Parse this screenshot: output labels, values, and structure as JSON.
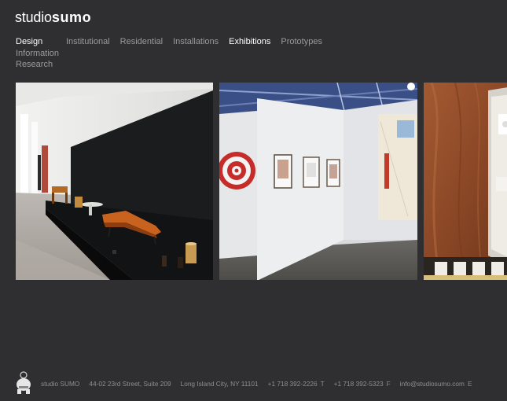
{
  "brand": {
    "logo_light": "studio",
    "logo_bold": "sumo"
  },
  "primary_nav": [
    {
      "label": "Design",
      "active": true
    },
    {
      "label": "Information",
      "active": false
    },
    {
      "label": "Research",
      "active": false
    }
  ],
  "secondary_nav": [
    {
      "label": "Institutional",
      "active": false
    },
    {
      "label": "Residential",
      "active": false
    },
    {
      "label": "Installations",
      "active": false
    },
    {
      "label": "Exhibitions",
      "active": true
    },
    {
      "label": "Prototypes",
      "active": false
    }
  ],
  "gallery": {
    "images": [
      {
        "subject": "furniture-exhibition-photo"
      },
      {
        "subject": "art-gallery-photo"
      },
      {
        "subject": "wood-panel-display-photo"
      }
    ]
  },
  "footer": {
    "icon": "sumo-wrestler-icon",
    "company": "studio SUMO",
    "address": "44-02 23rd Street, Suite 209",
    "city": "Long Island City, NY 11101",
    "phone": "+1 718 392-2226",
    "phone_suffix": "T",
    "fax": "+1 718 392-5323",
    "fax_suffix": "F",
    "email": "info@studiosumo.com",
    "email_suffix": "E"
  },
  "colors": {
    "background": "#2f2f31",
    "nav_text": "#9a9a9a",
    "nav_active": "#ffffff",
    "footer_text": "#8e8e8e"
  }
}
